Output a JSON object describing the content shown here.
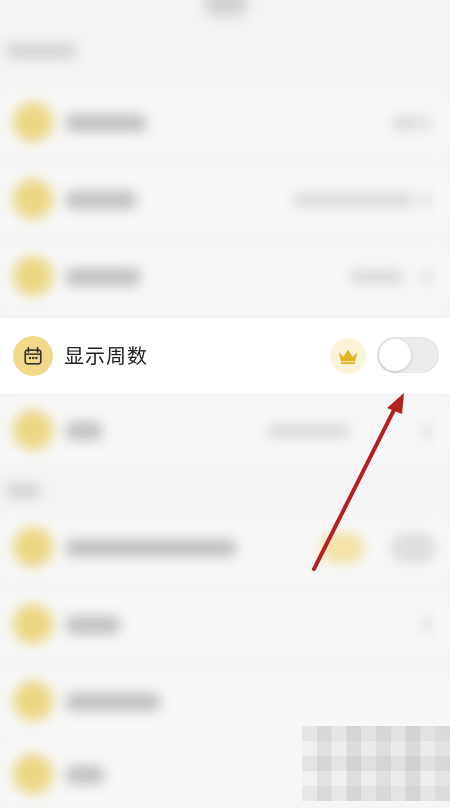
{
  "setting_row": {
    "label": "显示周数",
    "toggle_on": false
  },
  "icons": {
    "row_icon": "calendar-week-icon",
    "badge_icon": "crown-icon",
    "annotation": "red-arrow"
  },
  "colors": {
    "icon_bg": "#f1d98a",
    "icon_fg": "#333333",
    "crown": "#e2b322",
    "crown_bg": "#fbf3d7",
    "toggle_off": "#ececec",
    "arrow": "#b3201f"
  }
}
